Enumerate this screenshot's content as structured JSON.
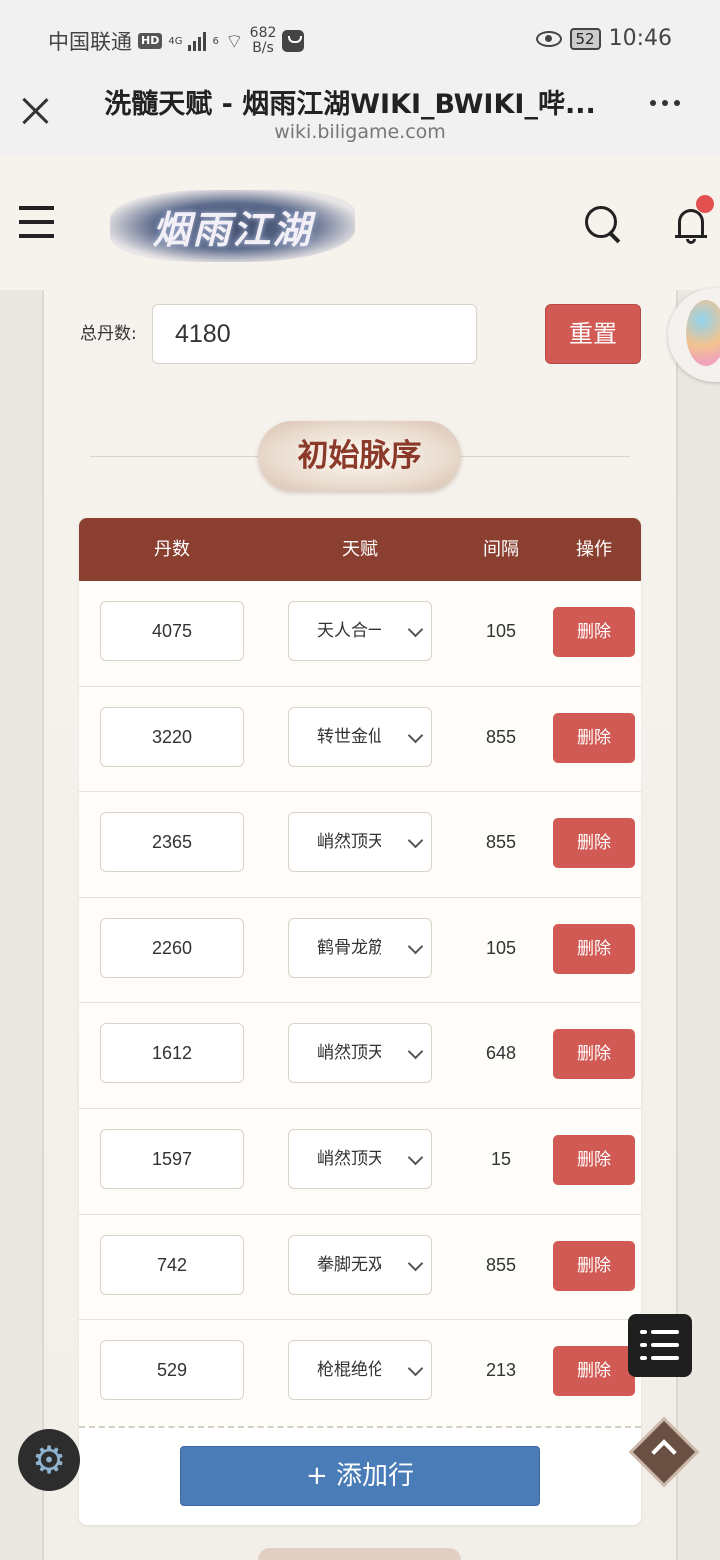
{
  "status_bar": {
    "carrier": "中国联通",
    "hd": "HD",
    "net_4g": "4G",
    "net_6": "6",
    "speed": "682",
    "speed_unit": "B/s",
    "battery": "52",
    "time": "10:46"
  },
  "browser": {
    "title": "洗髓天赋 - 烟雨江湖WIKI_BWIKI_哔...",
    "url": "wiki.biligame.com"
  },
  "site": {
    "logo_text": "烟雨江湖"
  },
  "form": {
    "total_label": "总丹数:",
    "total_value": "4180",
    "reset_label": "重置"
  },
  "section": {
    "title": "初始脉序"
  },
  "table": {
    "headers": [
      "丹数",
      "天赋",
      "间隔",
      "操作"
    ],
    "rows": [
      {
        "dan": "4075",
        "talent": "天人合一",
        "gap": "105",
        "action": "删除"
      },
      {
        "dan": "3220",
        "talent": "转世金仙",
        "gap": "855",
        "action": "删除"
      },
      {
        "dan": "2365",
        "talent": "峭然顶天",
        "gap": "855",
        "action": "删除"
      },
      {
        "dan": "2260",
        "talent": "鹤骨龙筋",
        "gap": "105",
        "action": "删除"
      },
      {
        "dan": "1612",
        "talent": "峭然顶天",
        "gap": "648",
        "action": "删除"
      },
      {
        "dan": "1597",
        "talent": "峭然顶天",
        "gap": "15",
        "action": "删除"
      },
      {
        "dan": "742",
        "talent": "拳脚无双",
        "gap": "855",
        "action": "删除"
      },
      {
        "dan": "529",
        "talent": "枪棍绝伦",
        "gap": "213",
        "action": "删除"
      }
    ],
    "add_row_label": "+ 添加行"
  },
  "icons": {
    "close": "close-icon",
    "more": "more-icon",
    "menu": "menu-icon",
    "search": "search-icon",
    "bell": "bell-icon",
    "list": "list-icon",
    "gear": "gear-icon",
    "up": "chevron-up-icon"
  },
  "colors": {
    "accent_red": "#d25a54",
    "header_brown": "#8a3f31",
    "add_blue": "#4a7cb8"
  }
}
